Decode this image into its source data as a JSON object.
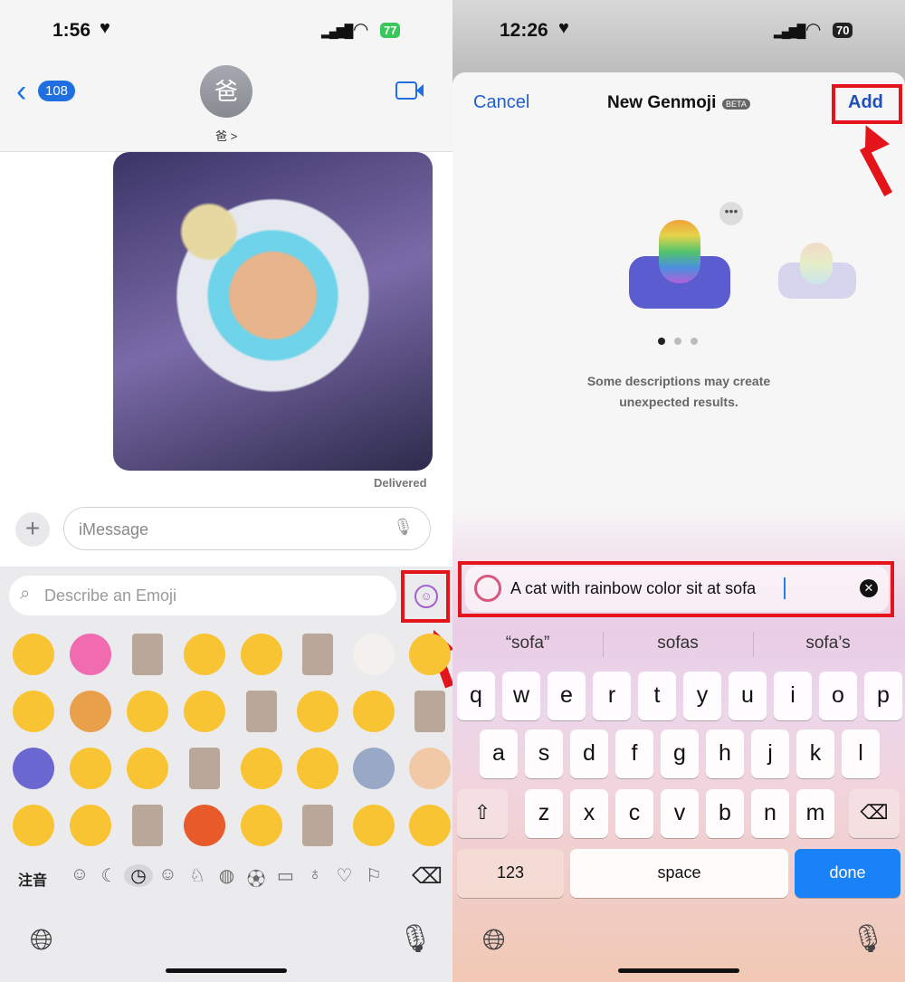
{
  "left": {
    "status": {
      "time": "1:56",
      "battery": "77"
    },
    "header": {
      "back_count": "108",
      "avatar_initial": "爸",
      "contact_name": "爸 >"
    },
    "message": {
      "status": "Delivered"
    },
    "compose": {
      "placeholder": "iMessage"
    },
    "emoji_search": {
      "placeholder": "Describe an Emoji"
    },
    "emoji_grid": [
      [
        "sad-tear-face",
        "pink-heart",
        "photo-sticker",
        "flushed-face",
        "confounded-face",
        "photo-sticker",
        "clown-face",
        "face-holding-tears"
      ],
      [
        "smiling-hearts-face",
        "rainbow-cat-genmoji",
        "pleading-face",
        "worried-face",
        "photo-sticker",
        "frowning-face",
        "slightly-smiling-face",
        "photo-sticker"
      ],
      [
        "cat-on-sofa-genmoji",
        "weary-face",
        "face-with-hands",
        "photo-sticker",
        "hushed-face",
        "face-with-thermometer",
        "sticker-characters",
        "folded-hands"
      ],
      [
        "heart-eyes-face",
        "crying-face",
        "photo-sticker",
        "angry-face",
        "surprised-face",
        "photo-sticker",
        "frowning-face",
        "grinning-face"
      ]
    ],
    "keyboard": {
      "lang_label": "注音",
      "categories": [
        "memoji-icon",
        "sticker-icon",
        "recent-icon",
        "smileys-icon",
        "animals-icon",
        "food-icon",
        "activity-icon",
        "travel-icon",
        "objects-icon",
        "symbols-icon",
        "flags-icon"
      ]
    }
  },
  "right": {
    "status": {
      "time": "12:26",
      "battery": "70"
    },
    "sheet": {
      "cancel": "Cancel",
      "title": "New Genmoji",
      "badge": "BETA",
      "add": "Add",
      "note_line1": "Some descriptions may create",
      "note_line2": "unexpected results."
    },
    "prompt": {
      "value": "A cat with rainbow color sit at sofa"
    },
    "suggestions": [
      "“sofa”",
      "sofas",
      "sofa’s"
    ],
    "keyboard": {
      "rows": [
        [
          "q",
          "w",
          "e",
          "r",
          "t",
          "y",
          "u",
          "i",
          "o",
          "p"
        ],
        [
          "a",
          "s",
          "d",
          "f",
          "g",
          "h",
          "j",
          "k",
          "l"
        ],
        [
          "z",
          "x",
          "c",
          "v",
          "b",
          "n",
          "m"
        ]
      ],
      "numbers": "123",
      "space": "space",
      "done": "done"
    }
  },
  "colors": {
    "accent": "#1f5fd0",
    "highlight": "#e4141b",
    "done": "#1a82f7"
  }
}
